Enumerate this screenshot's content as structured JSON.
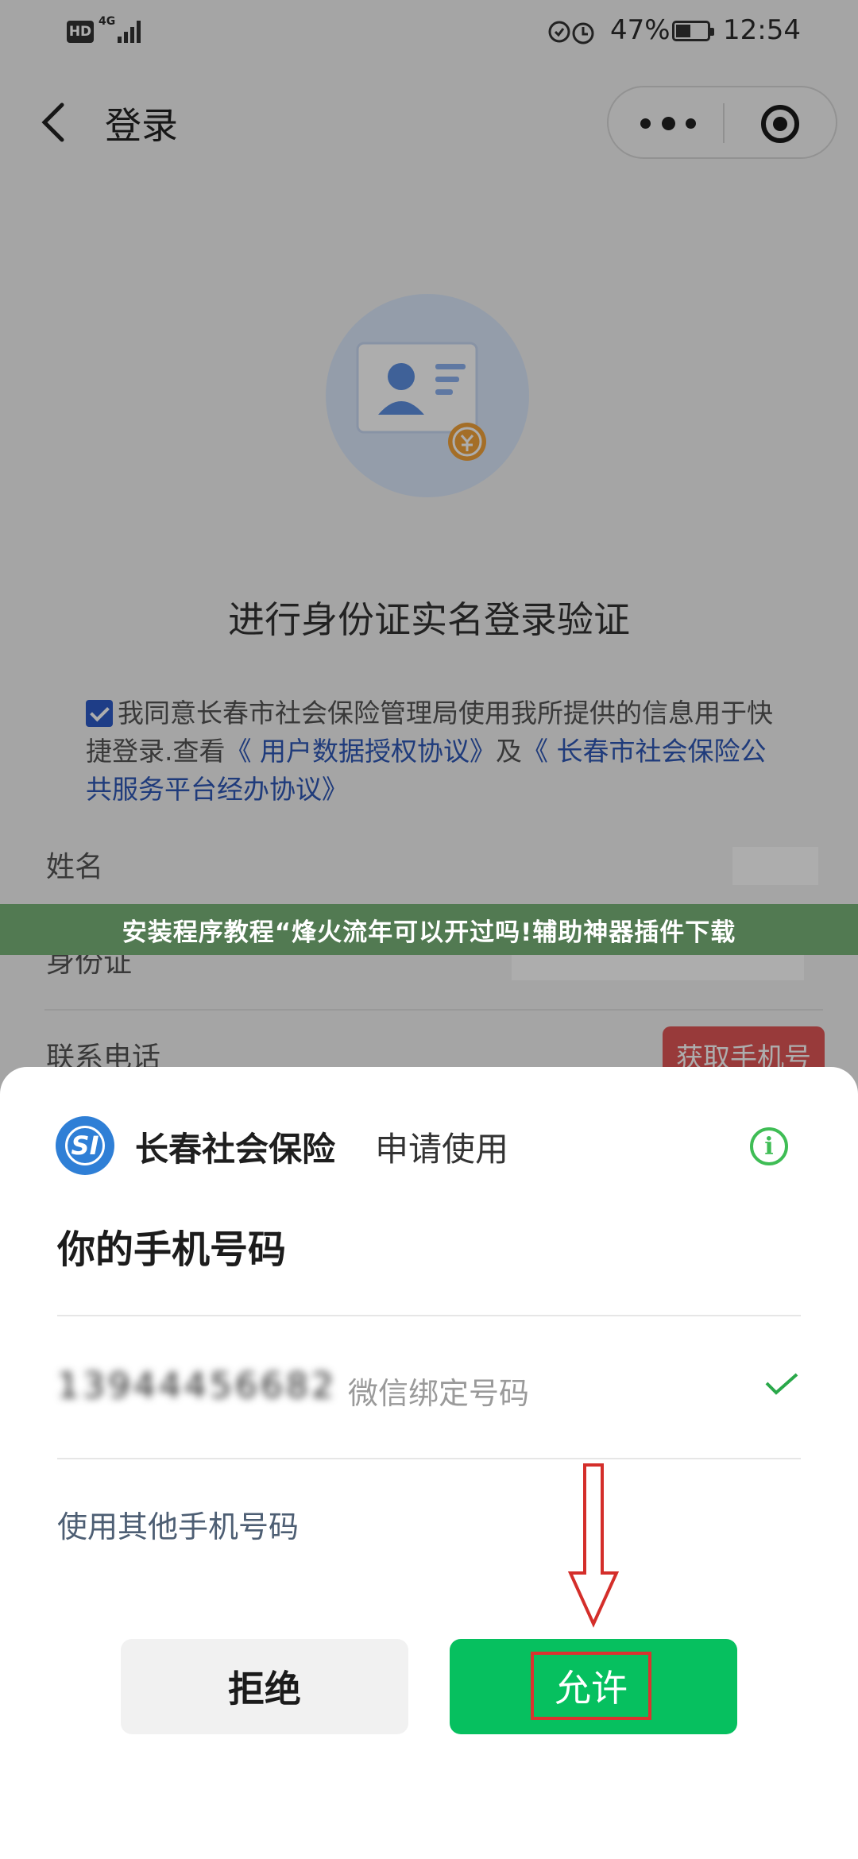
{
  "status_bar": {
    "hd": "HD",
    "network": "4G",
    "battery_percent": "47%",
    "battery_level": 0.47,
    "time": "12:54"
  },
  "navbar": {
    "title": "登录",
    "back_icon": "chevron-left-icon",
    "more_icon": "more-dots-icon",
    "close_icon": "close-miniprogram-icon"
  },
  "login_page": {
    "illustration": "id-card-icon",
    "verify_title": "进行身份证实名登录验证",
    "agreement": {
      "checked": true,
      "text_start": "我同意长春市社会保险管理局使用我所提供的信息用于快捷登录.查看",
      "link1": "《 用户数据授权协议》",
      "text_mid": "及",
      "link2": "《 长春市社会保险公共服务平台经办协议》"
    },
    "fields": {
      "name_label": "姓名",
      "id_label": "身份证",
      "phone_label": "联系电话",
      "get_phone_button": "获取手机号"
    }
  },
  "banner": {
    "text": "安装程序教程“烽火流年可以开过吗!辅助神器插件下载"
  },
  "sheet": {
    "app_logo": "si-logo-icon",
    "app_name": "长春社会保险",
    "request_text": "申请使用",
    "info_icon": "info-icon",
    "heading": "你的手机号码",
    "phone_number": "13944456682",
    "phone_note": "微信绑定号码",
    "selected_icon": "checkmark-icon",
    "other_phone": "使用其他手机号码",
    "reject_label": "拒绝",
    "allow_label": "允许"
  },
  "colors": {
    "wechat_green": "#06c05f",
    "link_blue": "#2e57b5",
    "annotation_red": "#d9332f",
    "banner_green": "#527a52"
  }
}
